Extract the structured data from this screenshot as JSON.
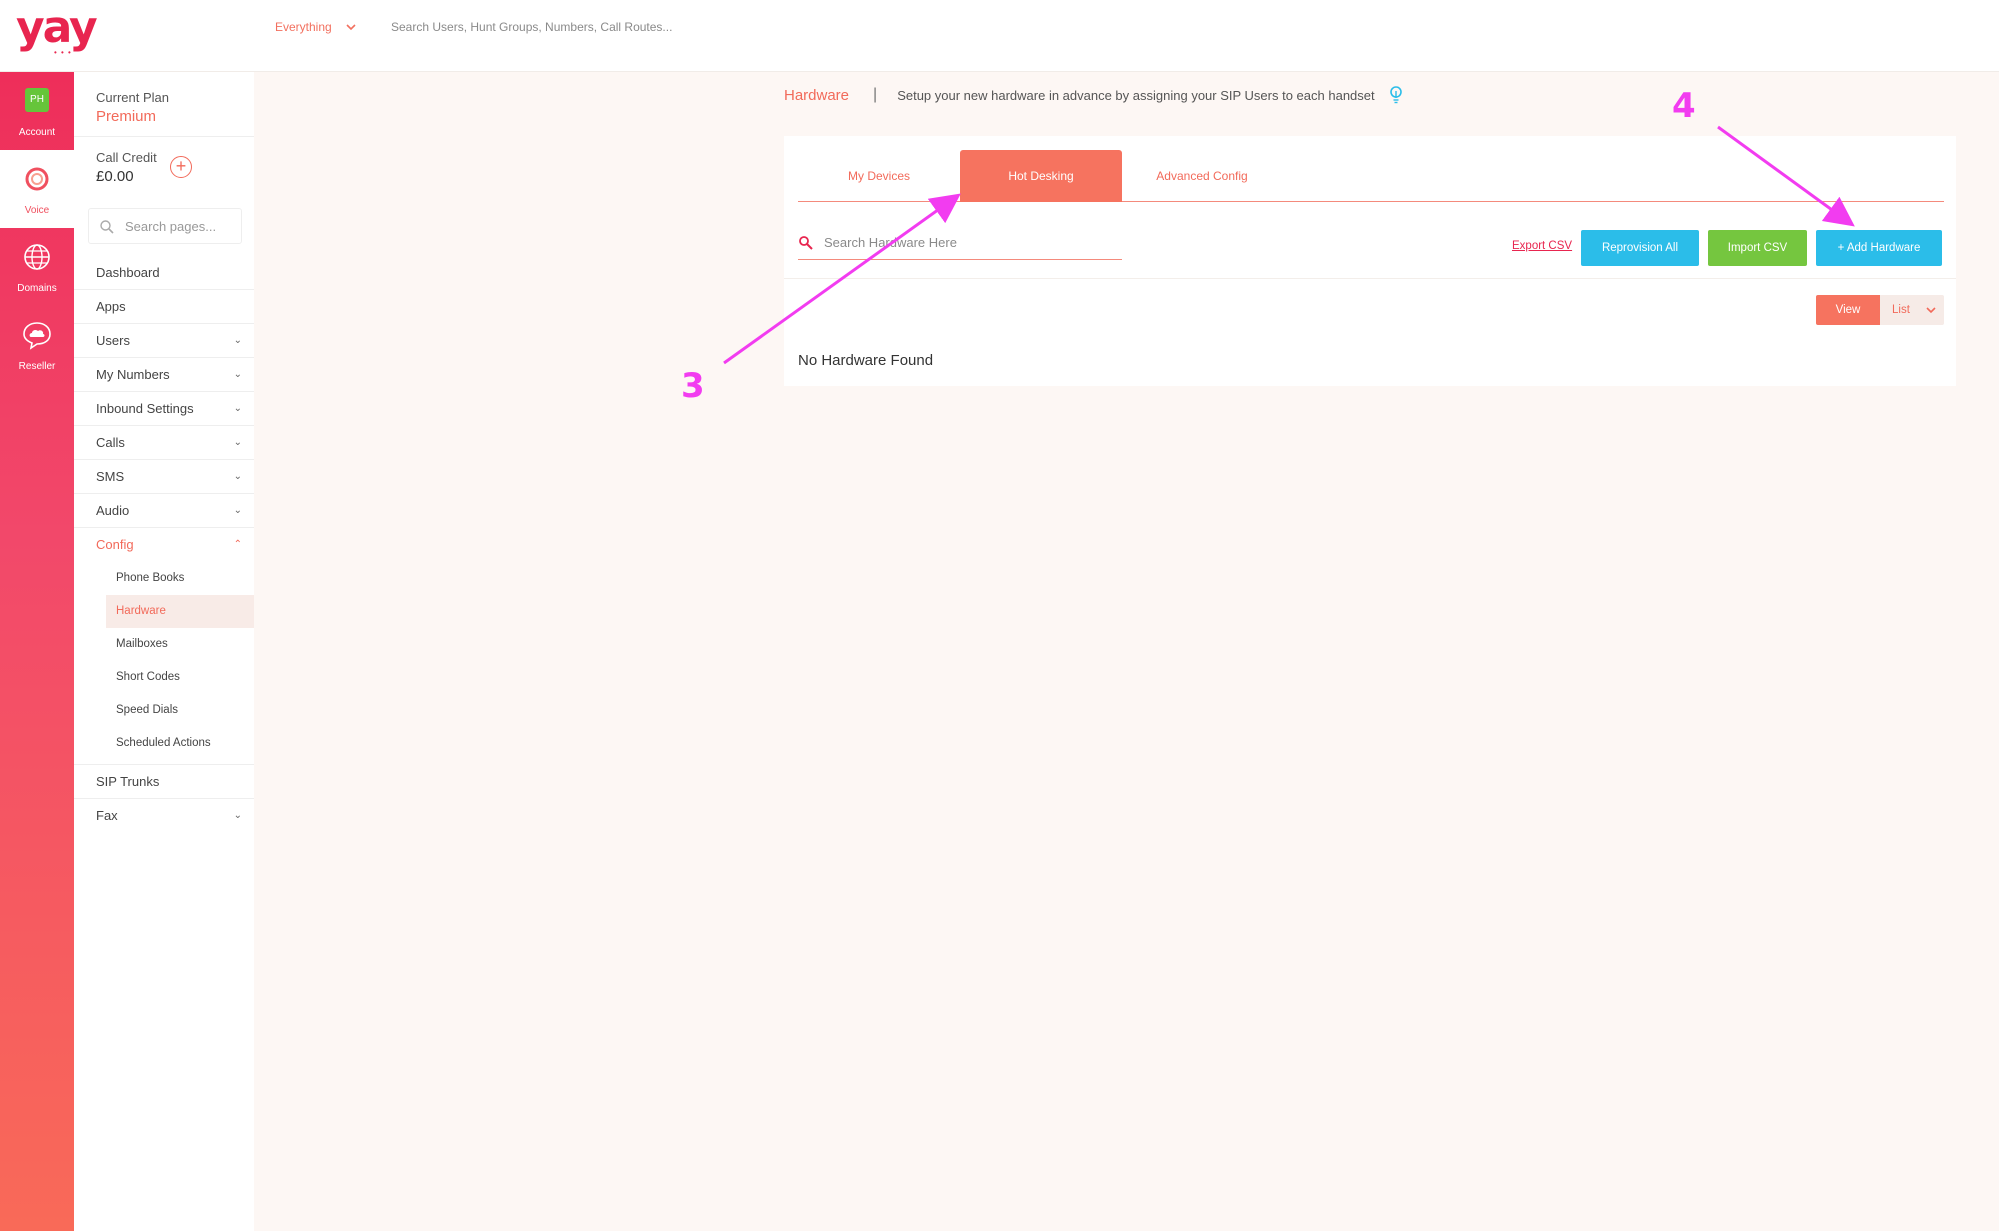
{
  "app": {
    "logo_text": "yay",
    "logo_dots": "• • •"
  },
  "topbar": {
    "scope_label": "Everything",
    "search_placeholder": "Search Users, Hunt Groups, Numbers, Call Routes..."
  },
  "rail": {
    "account": {
      "badge": "PH",
      "label": "Account"
    },
    "voice": {
      "label": "Voice"
    },
    "domains": {
      "label": "Domains"
    },
    "reseller": {
      "label": "Reseller"
    }
  },
  "sidebar": {
    "plan_label": "Current Plan",
    "plan_value": "Premium",
    "credit_label": "Call Credit",
    "credit_value": "£0.00",
    "credit_add": "+",
    "search_placeholder": "Search pages...",
    "menu": [
      {
        "label": "Dashboard",
        "chev": ""
      },
      {
        "label": "Apps",
        "chev": ""
      },
      {
        "label": "Users",
        "chev": "⌄"
      },
      {
        "label": "My Numbers",
        "chev": "⌄"
      },
      {
        "label": "Inbound Settings",
        "chev": "⌄"
      },
      {
        "label": "Calls",
        "chev": "⌄"
      },
      {
        "label": "SMS",
        "chev": "⌄"
      },
      {
        "label": "Audio",
        "chev": "⌄"
      },
      {
        "label": "Config",
        "chev": "⌃"
      }
    ],
    "config_sub": [
      "Phone Books",
      "Hardware",
      "Mailboxes",
      "Short Codes",
      "Speed Dials",
      "Scheduled Actions"
    ],
    "menu_after": [
      {
        "label": "SIP Trunks",
        "chev": ""
      },
      {
        "label": "Fax",
        "chev": "⌄"
      }
    ]
  },
  "page": {
    "title": "Hardware",
    "separator": "|",
    "description": "Setup your new hardware in advance by assigning your SIP Users to each handset"
  },
  "tabs": [
    "My Devices",
    "Hot Desking",
    "Advanced Config"
  ],
  "toolbar": {
    "search_placeholder": "Search Hardware Here",
    "export_label": "Export CSV",
    "reprovision_label": "Reprovision All",
    "import_label": "Import CSV",
    "add_label": "+ Add Hardware"
  },
  "view": {
    "view_label": "View",
    "list_label": "List"
  },
  "empty_message": "No Hardware Found",
  "annotations": {
    "step3": "3",
    "step4": "4",
    "color": "#f23cf0"
  },
  "colors": {
    "brand": "#e8254f",
    "accent": "#f6735f",
    "blue": "#2bbde9",
    "green": "#75c63f"
  }
}
